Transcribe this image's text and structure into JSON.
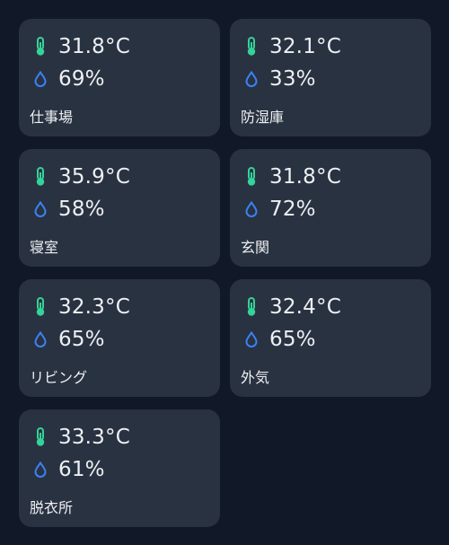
{
  "colors": {
    "background": "#111827",
    "card": "#293241",
    "thermometer": "#34d399",
    "droplet": "#3b82f6",
    "text": "#eef0f3"
  },
  "icons": {
    "temperature": "thermometer-icon",
    "humidity": "droplet-icon"
  },
  "rooms": [
    {
      "name": "仕事場",
      "temperature": "31.8°C",
      "humidity": "69%"
    },
    {
      "name": "防湿庫",
      "temperature": "32.1°C",
      "humidity": "33%"
    },
    {
      "name": "寝室",
      "temperature": "35.9°C",
      "humidity": "58%"
    },
    {
      "name": "玄関",
      "temperature": "31.8°C",
      "humidity": "72%"
    },
    {
      "name": "リビング",
      "temperature": "32.3°C",
      "humidity": "65%"
    },
    {
      "name": "外気",
      "temperature": "32.4°C",
      "humidity": "65%"
    },
    {
      "name": "脱衣所",
      "temperature": "33.3°C",
      "humidity": "61%"
    }
  ]
}
